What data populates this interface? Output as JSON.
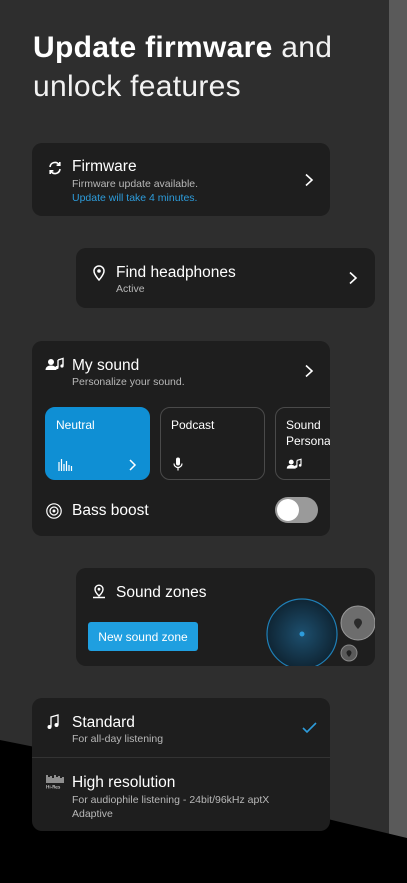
{
  "headline": {
    "bold": "Update firmware",
    "light": "and unlock features"
  },
  "firmware": {
    "title": "Firmware",
    "subtitle": "Firmware update available.",
    "link": "Update will take 4 minutes.",
    "icon": "refresh-icon"
  },
  "find": {
    "title": "Find headphones",
    "subtitle": "Active",
    "icon": "location-pin-icon"
  },
  "mysound": {
    "title": "My sound",
    "subtitle": "Personalize your sound.",
    "icon": "person-music-icon",
    "presets": [
      {
        "label": "Neutral",
        "icon": "equalizer-icon"
      },
      {
        "label": "Podcast",
        "icon": "microphone-icon"
      },
      {
        "label": "Sound Personal",
        "icon": "person-music-icon"
      }
    ],
    "bass_boost": {
      "label": "Bass boost",
      "enabled": false
    }
  },
  "zones": {
    "title": "Sound zones",
    "button": "New sound zone",
    "icon": "location-pin-icon"
  },
  "quality": {
    "items": [
      {
        "title": "Standard",
        "subtitle": "For all-day listening",
        "icon": "music-note-icon",
        "selected": true
      },
      {
        "title": "High resolution",
        "subtitle": "For audiophile listening - 24bit/96kHz aptX Adaptive",
        "icon": "hi-res-icon",
        "selected": false
      }
    ]
  },
  "colors": {
    "accent": "#0f8fd4",
    "link": "#2d9cdb",
    "card": "#1e1e1e",
    "background": "#2e2e2e"
  }
}
